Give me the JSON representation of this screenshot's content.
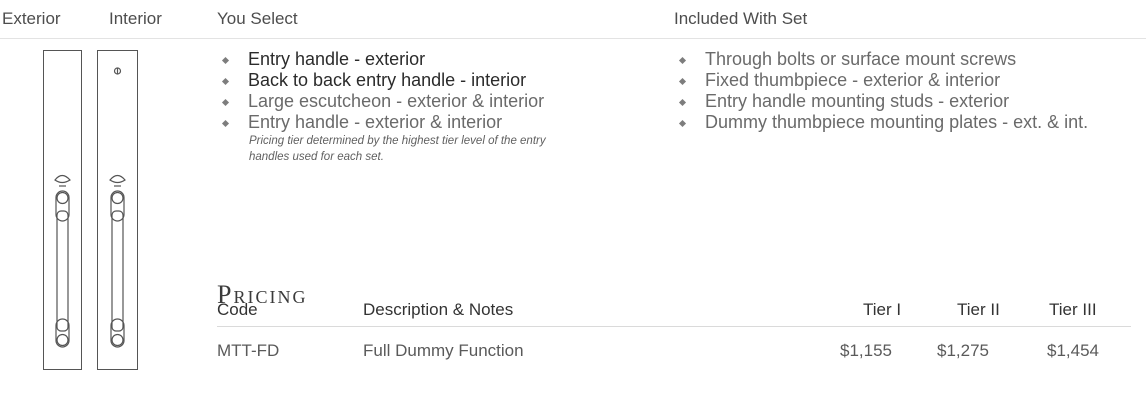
{
  "headers": {
    "exterior": "Exterior",
    "interior": "Interior",
    "you_select": "You Select",
    "included": "Included With Set"
  },
  "you_select": [
    {
      "text": "Entry handle - exterior",
      "emphasis": true
    },
    {
      "text": "Back to back entry handle - interior",
      "emphasis": true
    },
    {
      "text": "Large escutcheon - exterior & interior",
      "emphasis": false
    },
    {
      "text": "Entry handle - exterior & interior",
      "emphasis": false
    }
  ],
  "pricing_note": "Pricing tier determined by the highest tier level of the entry handles used for each set.",
  "included": [
    "Through bolts or surface mount screws",
    "Fixed thumbpiece - exterior & interior",
    "Entry handle mounting studs - exterior",
    "Dummy thumbpiece mounting plates - ext. & int."
  ],
  "pricing": {
    "title": "Pricing",
    "columns": {
      "code": "Code",
      "description": "Description & Notes",
      "tier1": "Tier I",
      "tier2": "Tier II",
      "tier3": "Tier III"
    },
    "rows": [
      {
        "code": "MTT-FD",
        "description": "Full Dummy Function",
        "tier1": "$1,155",
        "tier2": "$1,275",
        "tier3": "$1,454"
      }
    ]
  }
}
